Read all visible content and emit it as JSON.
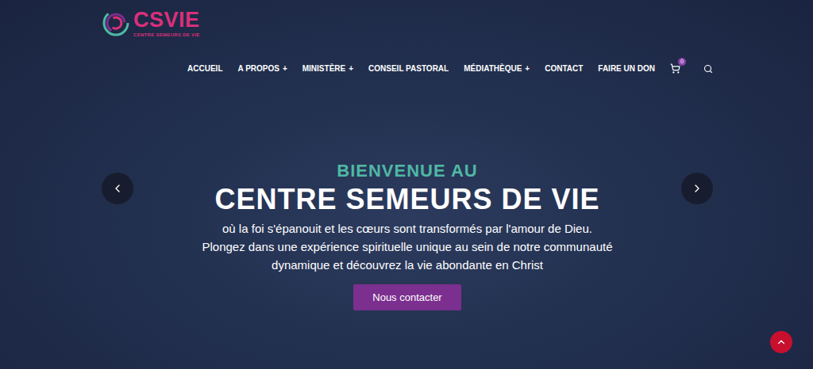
{
  "logo": {
    "title": "CSVIE",
    "subtitle": "CENTRE SEMEURS DE VIE"
  },
  "nav": {
    "items": [
      {
        "label": "ACCUEIL",
        "submenu": "",
        "selected": false
      },
      {
        "label": "A PROPOS",
        "submenu": "+",
        "selected": false
      },
      {
        "label": "MINISTÈRE",
        "submenu": "+",
        "selected": false
      },
      {
        "label": "CONSEIL PASTORAL",
        "submenu": "",
        "selected": false
      },
      {
        "label": "MÉDIATHÈQUE",
        "submenu": "+",
        "selected": false
      },
      {
        "label": "CONTACT",
        "submenu": "",
        "selected": false
      },
      {
        "label": "FAIRE UN DON",
        "submenu": "",
        "selected": false
      }
    ],
    "cart_count": "0"
  },
  "hero": {
    "eyebrow": "BIENVENUE AU",
    "title": "CENTRE SEMEURS DE VIE",
    "lines": [
      "où la foi s'épanouit et les cœurs sont transformés par l'amour de Dieu.",
      "Plongez dans une expérience spirituelle unique au sein de notre communauté",
      "dynamique et découvrez la vie abondante en Christ"
    ],
    "button": "Nous contacter"
  }
}
